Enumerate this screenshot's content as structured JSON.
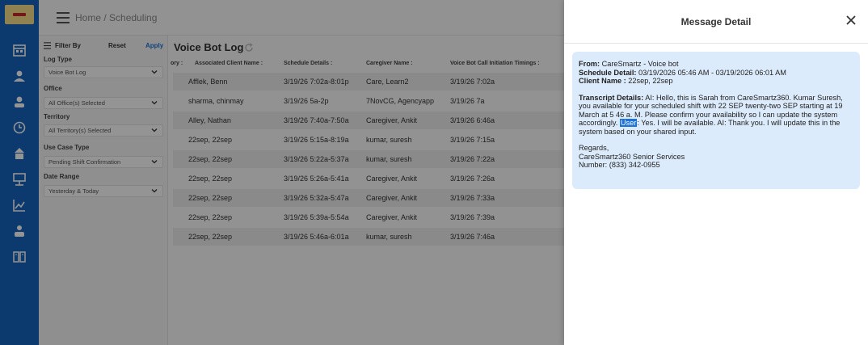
{
  "topbar": {
    "breadcrumb": "Home / Scheduling"
  },
  "filter": {
    "title": "Filter By",
    "reset": "Reset",
    "apply": "Apply",
    "fields": [
      {
        "label": "Log Type",
        "value": "Voice Bot Log"
      },
      {
        "label": "Office",
        "value": "All Office(s) Selected"
      },
      {
        "label": "Territory",
        "value": "All Territory(s) Selected"
      },
      {
        "label": "Use Case Type",
        "value": "Pending Shift Confirmation"
      },
      {
        "label": "Date Range",
        "value": "Yesterday & Today"
      }
    ]
  },
  "main": {
    "title": "Voice Bot Log",
    "columns": [
      "ory :",
      "Associated Client Name :",
      "Schedule Details :",
      "Caregiver Name :",
      "Voice Bot Call Initiation Timings :"
    ],
    "rows": [
      [
        "Afflek, Benn",
        "3/19/26 7:02a-8:01p",
        "Care, Learn2",
        "3/19/26 7:02a"
      ],
      [
        "sharma, chinmay",
        "3/19/26 5a-2p",
        "7NovCG, Agencyapp",
        "3/19/26 7a"
      ],
      [
        "Alley, Nathan",
        "3/19/26 7:40a-7:50a",
        "Caregiver, Ankit",
        "3/19/26 6:46a"
      ],
      [
        "22sep, 22sep",
        "3/19/26 5:15a-8:19a",
        "kumar, suresh",
        "3/19/26 7:15a"
      ],
      [
        "22sep, 22sep",
        "3/19/26 5:22a-5:37a",
        "kumar, suresh",
        "3/19/26 7:22a"
      ],
      [
        "22sep, 22sep",
        "3/19/26 5:26a-5:41a",
        "Caregiver, Ankit",
        "3/19/26 7:26a"
      ],
      [
        "22sep, 22sep",
        "3/19/26 5:32a-5:47a",
        "Caregiver, Ankit",
        "3/19/26 7:33a"
      ],
      [
        "22sep, 22sep",
        "3/19/26 5:39a-5:54a",
        "Caregiver, Ankit",
        "3/19/26 7:39a"
      ],
      [
        "22sep, 22sep",
        "3/19/26 5:46a-6:01a",
        "kumar, suresh",
        "3/19/26 7:46a"
      ]
    ]
  },
  "detail": {
    "title": "Message Detail",
    "from_label": "From:",
    "from_value": " CareSmartz - Voice bot",
    "schedule_label": "Schedule Detail:",
    "schedule_value": " 03/19/2026 05:46 AM - 03/19/2026 06:01 AM",
    "client_label": "Client Name :",
    "client_value": " 22sep, 22sep",
    "transcript_label": "Transcript Details:",
    "transcript_before": " AI: Hello, this is Sarah from CareSmartz360. Kumar Suresh, you available for your scheduled shift with 22 SEP twenty-two SEP starting at 19 March at 5 46 a. M. Please confirm your availability so I can update the system accordingly. ",
    "transcript_highlight": "User",
    "transcript_after": ": Yes. I will be available. AI: Thank you. I will update this in the system based on your shared input.",
    "regards": "Regards,",
    "company": "CareSmartz360 Senior Services",
    "number": "Number: (833) 342-0955"
  },
  "colors": {
    "sidebar": "#1565c0",
    "accent": "#1e73d8",
    "message_bg": "#dcebfb"
  },
  "icons": [
    "menu-icon",
    "filter-icon",
    "chevron-down-icon",
    "refresh-icon",
    "close-icon",
    "calendar-icon",
    "user-icon",
    "clock-icon",
    "chart-icon",
    "book-icon"
  ]
}
